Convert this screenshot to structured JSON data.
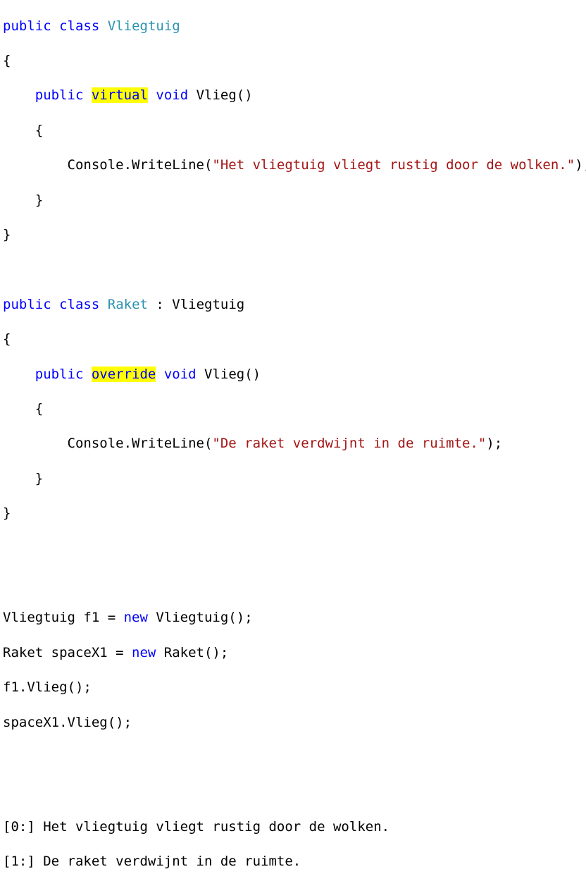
{
  "class1": {
    "line_open": "{",
    "kw_public": "public",
    "kw_class": "class",
    "name": "Vliegtuig",
    "kw_public_method": "public",
    "modifier": "virtual",
    "kw_void": "void",
    "method_sig": "Vlieg()",
    "method_open": "{",
    "call_prefix": "Console.WriteLine(",
    "string": "\"Het vliegtuig vliegt rustig door de wolken.\"",
    "call_suffix": ");",
    "method_close": "}",
    "line_close": "}"
  },
  "class2": {
    "kw_public": "public",
    "kw_class": "class",
    "name": "Raket",
    "inherit": " : Vliegtuig",
    "line_open": "{",
    "kw_public_method": "public",
    "modifier": "override",
    "kw_void": "void",
    "method_sig": "Vlieg()",
    "method_open": "{",
    "call_prefix": "Console.WriteLine(",
    "string": "\"De raket verdwijnt in de ruimte.\"",
    "call_suffix": ");",
    "method_close": "}",
    "line_close": "}"
  },
  "usage": {
    "l1_a": "Vliegtuig f1 = ",
    "l1_kw": "new",
    "l1_b": " Vliegtuig();",
    "l2_a": "Raket spaceX1 = ",
    "l2_kw": "new",
    "l2_b": " Raket();",
    "l3": "f1.Vlieg();",
    "l4": "spaceX1.Vlieg();"
  },
  "output": {
    "line1": "[0:] Het vliegtuig vliegt rustig door de wolken.",
    "line2": "[1:] De raket verdwijnt in de ruimte."
  },
  "colors": {
    "keyword": "#0000ff",
    "type": "#2b91af",
    "string": "#a31515",
    "highlight": "#ffff00"
  }
}
